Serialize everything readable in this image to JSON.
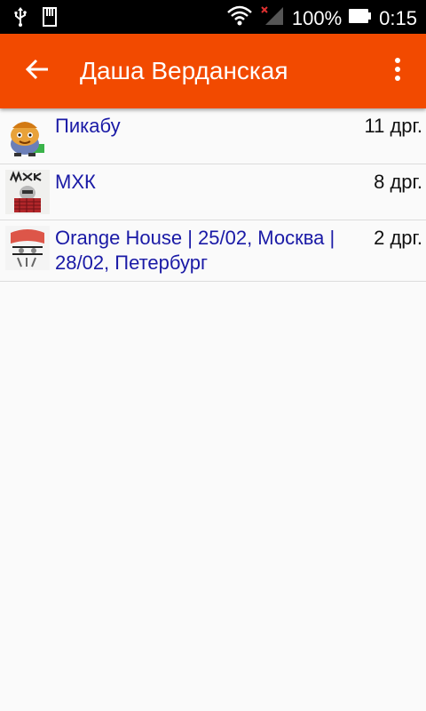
{
  "status_bar": {
    "battery_text": "100%",
    "time": "0:15"
  },
  "app_bar": {
    "title": "Даша Верданская",
    "back_icon": "arrow-back-icon",
    "menu_icon": "more-vert-icon",
    "color": "#f24a00"
  },
  "list": {
    "items": [
      {
        "name": "Пикабу",
        "count": "11 дрг."
      },
      {
        "name": "МХК",
        "count": "8 дрг."
      },
      {
        "name": "Orange House | 25/02, Москва | 28/02, Петербург",
        "count": "2 дрг."
      }
    ]
  }
}
